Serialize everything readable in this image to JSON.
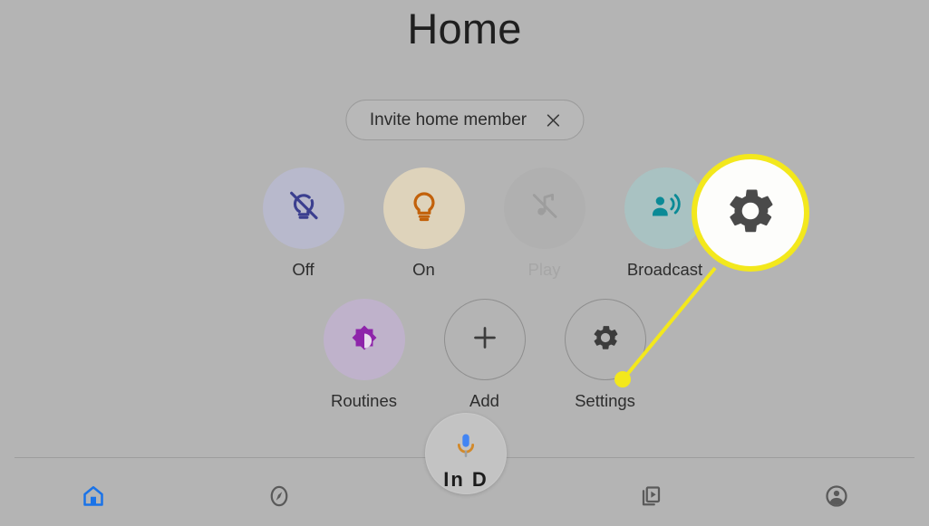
{
  "header": {
    "title": "Home"
  },
  "invite": {
    "label": "Invite home member",
    "close_icon": "close-icon"
  },
  "quick_actions": {
    "row1": [
      {
        "label": "Off",
        "icon": "lightbulb-off-icon",
        "icon_color": "#3b3f8f",
        "bubble_color": "#b8b9cc",
        "disabled": false
      },
      {
        "label": "On",
        "icon": "lightbulb-on-icon",
        "icon_color": "#c2610a",
        "bubble_color": "#ded3bb",
        "disabled": false
      },
      {
        "label": "Play",
        "icon": "music-note-off-icon",
        "icon_color": "#a0a0a0",
        "bubble_color": "#b0b0b0",
        "disabled": true
      },
      {
        "label": "Broadcast",
        "icon": "broadcast-person-icon",
        "icon_color": "#0b8a96",
        "bubble_color": "#a9c2c2",
        "disabled": false
      }
    ],
    "row2": [
      {
        "label": "Routines",
        "icon": "brightness-star-icon",
        "icon_color": "#8e24aa",
        "bubble_color": "#bfb2cb",
        "style": "filled"
      },
      {
        "label": "Add",
        "icon": "plus-icon",
        "icon_color": "#3c3c3c",
        "bubble_color": "transparent",
        "style": "outline"
      },
      {
        "label": "Settings",
        "icon": "gear-icon",
        "icon_color": "#3c3c3c",
        "bubble_color": "transparent",
        "style": "outline"
      }
    ]
  },
  "highlight": {
    "target": "settings-gear",
    "icon": "gear-icon",
    "ring_color": "#f3e81c",
    "fill_color": "#fdfdfb",
    "icon_color": "#4a4a4a"
  },
  "assistant_fab": {
    "icon": "microphone-icon",
    "mic_color": "#4285f4",
    "base_color": "#d2892a",
    "clipped_label": "In D"
  },
  "bottom_nav": [
    {
      "label": "Home",
      "icon": "home-icon",
      "active": true
    },
    {
      "label": "Explore",
      "icon": "compass-icon",
      "active": false
    },
    {
      "label": "Assistant",
      "icon": "microphone-icon",
      "active": false
    },
    {
      "label": "Media",
      "icon": "media-play-icon",
      "active": false
    },
    {
      "label": "Account",
      "icon": "account-circle-icon",
      "active": false
    }
  ]
}
